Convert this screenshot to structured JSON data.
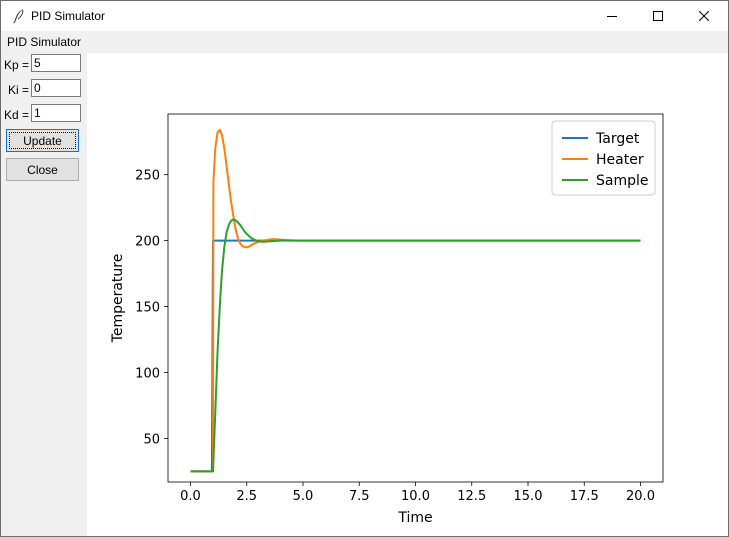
{
  "window": {
    "title": "PID Simulator",
    "app_label": "PID Simulator"
  },
  "params": [
    {
      "label": "Kp =",
      "value": "5"
    },
    {
      "label": "Ki =",
      "value": "0"
    },
    {
      "label": "Kd =",
      "value": "1"
    }
  ],
  "buttons": {
    "update": "Update",
    "close": "Close"
  },
  "colors": {
    "target": "#1f77b4",
    "heater": "#ff7f0e",
    "sample": "#2ca02c"
  },
  "chart_data": {
    "type": "line",
    "xlabel": "Time",
    "ylabel": "Temperature",
    "xlim": [
      -1.0,
      21.0
    ],
    "ylim": [
      17,
      296
    ],
    "xticks": [
      0.0,
      2.5,
      5.0,
      7.5,
      10.0,
      12.5,
      15.0,
      17.5,
      20.0
    ],
    "xtick_labels": [
      "0.0",
      "2.5",
      "5.0",
      "7.5",
      "10.0",
      "12.5",
      "15.0",
      "17.5",
      "20.0"
    ],
    "yticks": [
      50,
      100,
      150,
      200,
      250
    ],
    "ytick_labels": [
      "50",
      "100",
      "150",
      "200",
      "250"
    ],
    "legend_position": "top-right",
    "series": [
      {
        "name": "Target",
        "x": [
          0.0,
          0.95,
          1.0,
          20.0
        ],
        "y": [
          25,
          25,
          200,
          200
        ]
      },
      {
        "name": "Heater",
        "x": [
          0.0,
          1.0,
          1.02,
          1.1,
          1.2,
          1.3,
          1.4,
          1.5,
          1.6,
          1.7,
          1.8,
          1.9,
          2.0,
          2.1,
          2.2,
          2.3,
          2.4,
          2.5,
          2.6,
          2.7,
          2.8,
          3.0,
          3.2,
          3.4,
          3.6,
          3.8,
          4.0,
          4.3,
          4.7,
          5.0,
          20.0
        ],
        "y": [
          25,
          25,
          245,
          270,
          282,
          284,
          280,
          270,
          257,
          243,
          230,
          219,
          209,
          202,
          198,
          196,
          195,
          195,
          195.5,
          196.5,
          197.5,
          199,
          200,
          200.5,
          201,
          201,
          200.8,
          200.4,
          200.1,
          200,
          200
        ]
      },
      {
        "name": "Sample",
        "x": [
          0.0,
          1.0,
          1.1,
          1.2,
          1.3,
          1.4,
          1.5,
          1.6,
          1.7,
          1.8,
          1.9,
          2.0,
          2.1,
          2.2,
          2.3,
          2.4,
          2.5,
          2.6,
          2.7,
          2.8,
          2.9,
          3.0,
          3.2,
          3.4,
          3.6,
          3.8,
          4.0,
          4.5,
          5.0,
          20.0
        ],
        "y": [
          25,
          25,
          70,
          115,
          150,
          177,
          195,
          206,
          212,
          215,
          216,
          215.5,
          214,
          212,
          209.5,
          207,
          205,
          203.5,
          202,
          201,
          200.2,
          199.6,
          199.2,
          199.3,
          199.6,
          199.9,
          200.1,
          200.1,
          200,
          200
        ]
      }
    ]
  }
}
